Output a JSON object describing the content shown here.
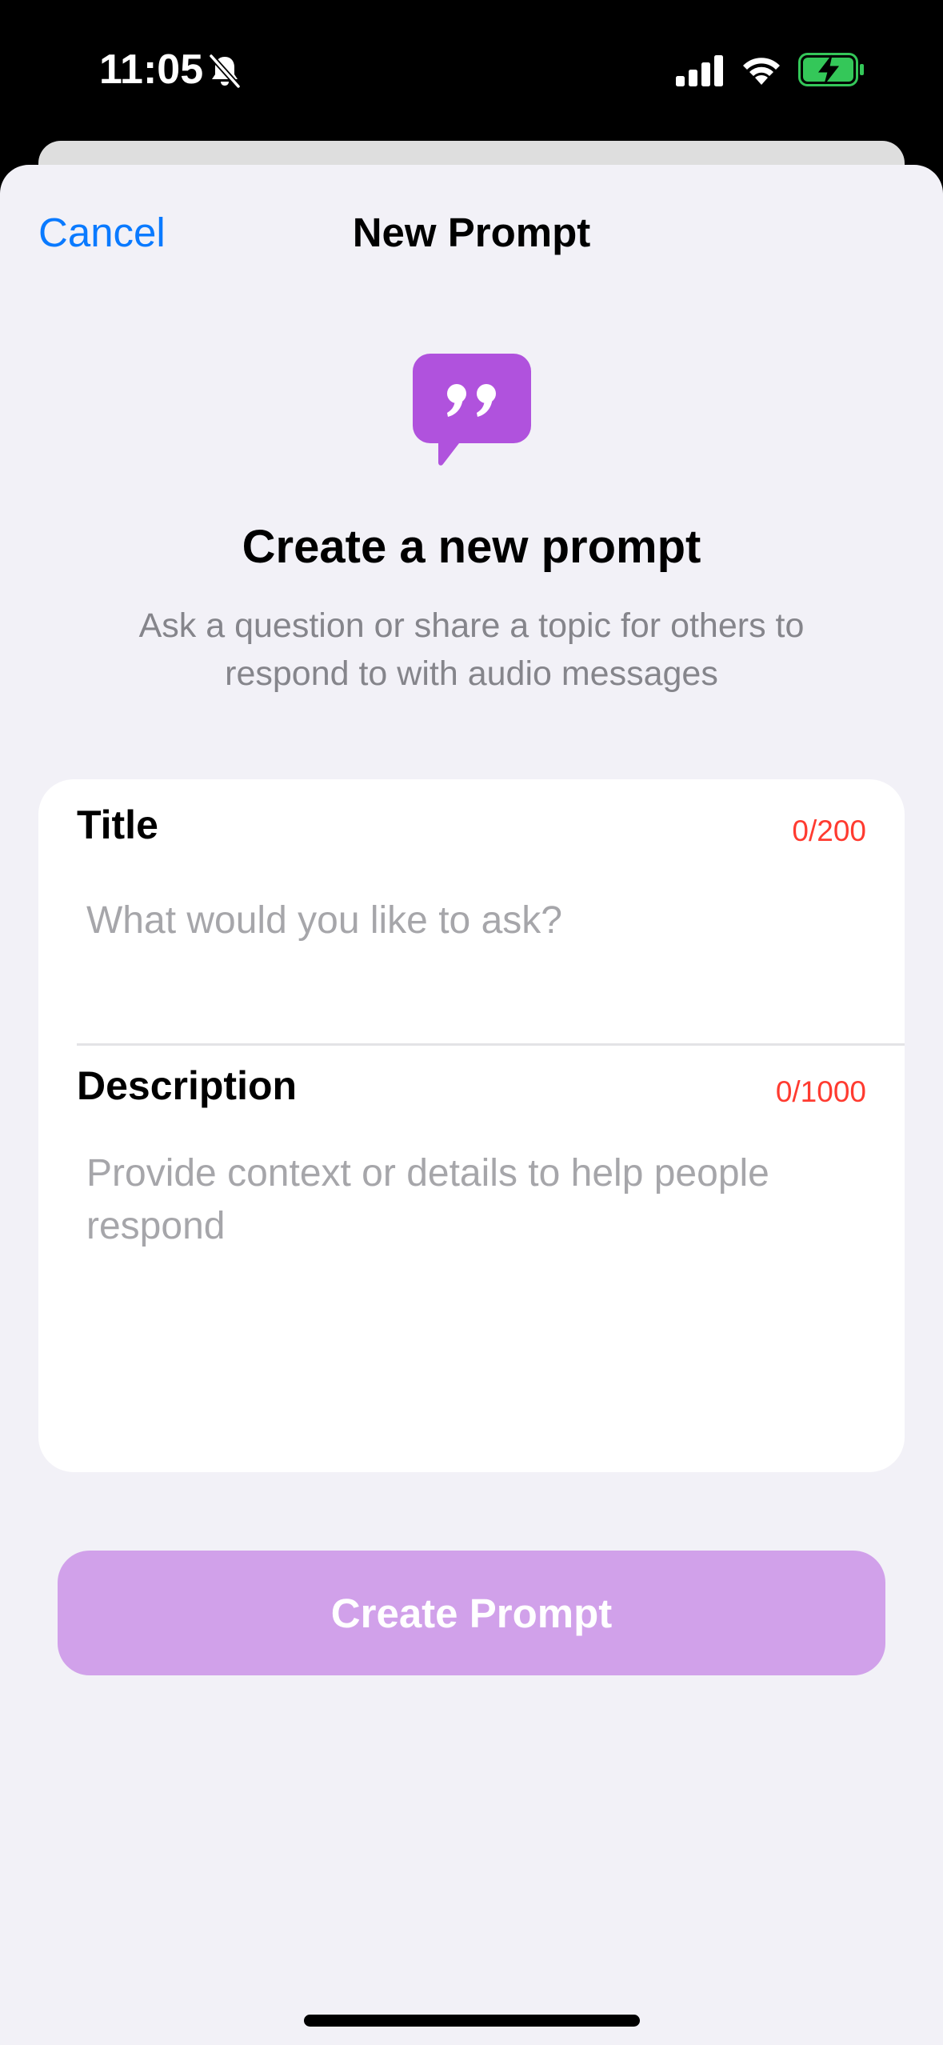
{
  "status_bar": {
    "time": "11:05",
    "icons": [
      "bell-slash-icon",
      "cellular-signal-icon",
      "wifi-icon",
      "battery-charging-icon"
    ],
    "battery_color": "#34c759"
  },
  "nav": {
    "cancel_label": "Cancel",
    "title": "New Prompt"
  },
  "hero": {
    "icon": "quote-bubble-icon",
    "icon_color": "#b052dd",
    "heading": "Create a new prompt",
    "subtitle": "Ask a question or share a topic for others to respond to with audio messages"
  },
  "form": {
    "title_field": {
      "label": "Title",
      "counter": "0/200",
      "value": "",
      "placeholder": "What would you like to ask?"
    },
    "description_field": {
      "label": "Description",
      "counter": "0/1000",
      "value": "",
      "placeholder": "Provide context or details to help people respond"
    }
  },
  "create_button": {
    "label": "Create Prompt",
    "color": "#d1a1ea",
    "enabled": false
  },
  "colors": {
    "accent": "#0a7aff",
    "counter": "#ff3b30",
    "sheet_background": "#f2f1f7"
  }
}
